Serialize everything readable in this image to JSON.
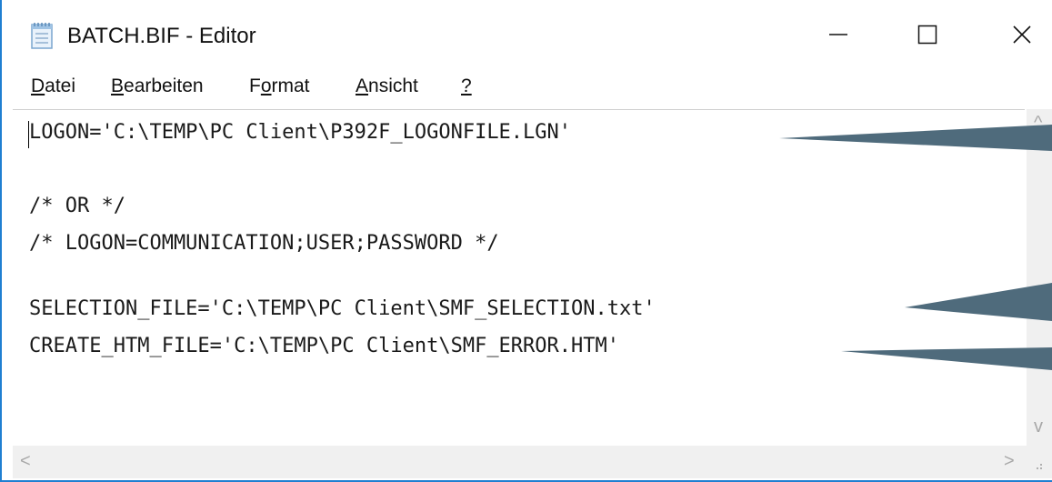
{
  "window": {
    "title": "BATCH.BIF - Editor",
    "icon": "notepad-icon",
    "border_color": "#1f7fd1"
  },
  "controls": {
    "minimize_icon": "minimize-icon",
    "maximize_icon": "maximize-icon",
    "close_icon": "close-icon"
  },
  "menu": [
    {
      "label": "Datei",
      "accel": "D",
      "rest": "atei"
    },
    {
      "label": "Bearbeiten",
      "accel": "B",
      "rest": "earbeiten"
    },
    {
      "label": "Format",
      "pre": "F",
      "accel": "o",
      "rest": "rmat"
    },
    {
      "label": "Ansicht",
      "accel": "A",
      "rest": "nsicht"
    },
    {
      "label": "?",
      "accel": "?",
      "rest": ""
    }
  ],
  "editor": {
    "lines": [
      "LOGON='C:\\TEMP\\PC Client\\P392F_LOGONFILE.LGN'",
      "",
      "/* OR */",
      "/* LOGON=COMMUNICATION;USER;PASSWORD */",
      "",
      "SELECTION_FILE='C:\\TEMP\\PC Client\\SMF_SELECTION.txt'",
      "CREATE_HTM_FILE='C:\\TEMP\\PC Client\\SMF_ERROR.HTM'"
    ]
  },
  "scrollbars": {
    "up_arrow": "^",
    "down_arrow": "v",
    "left_arrow": "<",
    "right_arrow": ">"
  },
  "callout_color": "#4f6b7c"
}
